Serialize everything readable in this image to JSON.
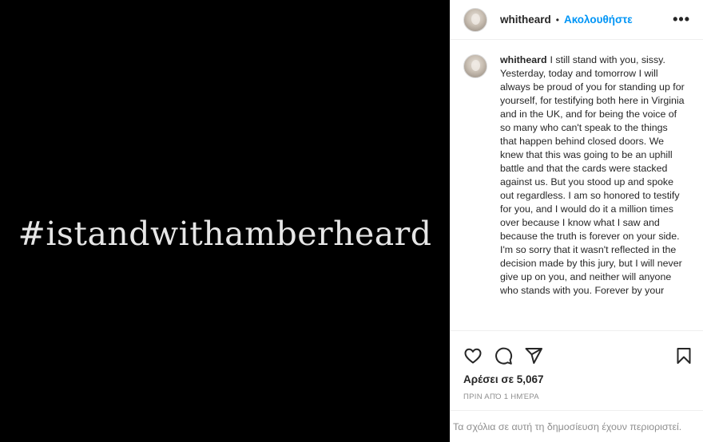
{
  "post": {
    "media_text": "#istandwithamberheard"
  },
  "header": {
    "username": "whitheard",
    "separator": "•",
    "follow_label": "Ακολουθήστε",
    "more_icon": "more-horizontal-icon",
    "more_label": "•••"
  },
  "caption": {
    "username": "whitheard",
    "text": "I still stand with you, sissy. Yesterday, today and tomorrow I will always be proud of you for standing up for yourself, for testifying both here in Virginia and in the UK, and for being the voice of so many who can't speak to the things that happen behind closed doors. We knew that this was going to be an uphill battle and that the cards were stacked against us. But you stood up and spoke out regardless. I am so honored to testify for you, and I would do it a million times over because I know what I saw and because the truth is forever on your side. I'm so sorry that it wasn't reflected in the decision made by this jury, but I will never give up on you, and neither will anyone who stands with you. Forever by your"
  },
  "actions": {
    "like_icon": "heart-icon",
    "comment_icon": "comment-icon",
    "share_icon": "share-icon",
    "save_icon": "bookmark-icon"
  },
  "likes_text": "Αρέσει σε 5,067",
  "timestamp": "ΠΡΙΝ ΑΠΌ 1 ΗΜΈΡΑ",
  "comments_notice": "Τα σχόλια σε αυτή τη δημοσίευση έχουν περιοριστεί.",
  "colors": {
    "accent": "#0095f6",
    "media_background": "#000000",
    "muted_text": "#8e8e8e"
  }
}
